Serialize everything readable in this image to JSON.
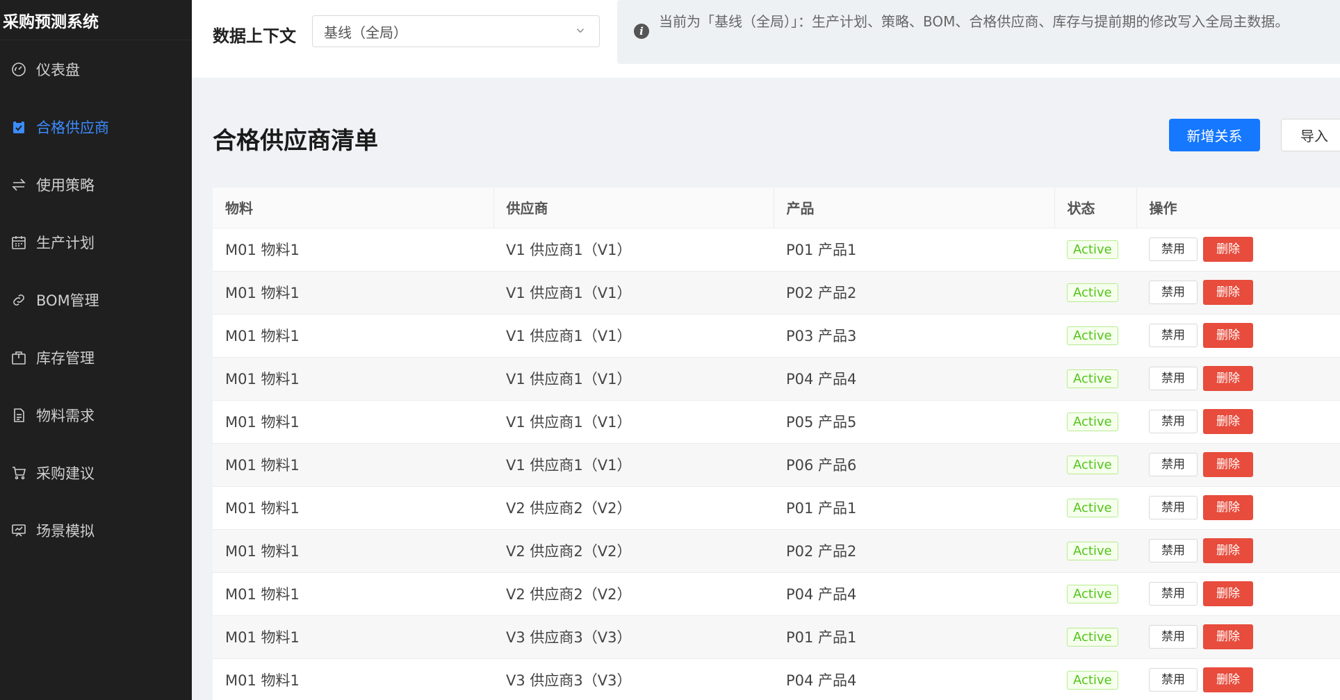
{
  "app": {
    "title": "采购预测系统"
  },
  "sidebar": {
    "items": [
      {
        "label": "仪表盘",
        "icon": "dashboard-icon",
        "active": false
      },
      {
        "label": "合格供应商",
        "icon": "checklist-icon",
        "active": true
      },
      {
        "label": "使用策略",
        "icon": "swap-icon",
        "active": false
      },
      {
        "label": "生产计划",
        "icon": "calendar-icon",
        "active": false
      },
      {
        "label": "BOM管理",
        "icon": "link-icon",
        "active": false
      },
      {
        "label": "库存管理",
        "icon": "box-icon",
        "active": false
      },
      {
        "label": "物料需求",
        "icon": "document-icon",
        "active": false
      },
      {
        "label": "采购建议",
        "icon": "cart-icon",
        "active": false
      },
      {
        "label": "场景模拟",
        "icon": "presentation-icon",
        "active": false
      }
    ]
  },
  "context": {
    "label": "数据上下文",
    "selected": "基线（全局）",
    "info": "当前为「基线（全局）」：生产计划、策略、BOM、合格供应商、库存与提前期的修改写入全局主数据。"
  },
  "main": {
    "title": "合格供应商清单",
    "add_button": "新增关系",
    "import_button": "导入"
  },
  "table": {
    "headers": {
      "material": "物料",
      "supplier": "供应商",
      "product": "产品",
      "status": "状态",
      "actions": "操作"
    },
    "disable_label": "禁用",
    "delete_label": "删除",
    "rows": [
      {
        "material": "M01 物料1",
        "supplier": "V1 供应商1（V1）",
        "product": "P01 产品1",
        "status": "Active"
      },
      {
        "material": "M01 物料1",
        "supplier": "V1 供应商1（V1）",
        "product": "P02 产品2",
        "status": "Active"
      },
      {
        "material": "M01 物料1",
        "supplier": "V1 供应商1（V1）",
        "product": "P03 产品3",
        "status": "Active"
      },
      {
        "material": "M01 物料1",
        "supplier": "V1 供应商1（V1）",
        "product": "P04 产品4",
        "status": "Active"
      },
      {
        "material": "M01 物料1",
        "supplier": "V1 供应商1（V1）",
        "product": "P05 产品5",
        "status": "Active"
      },
      {
        "material": "M01 物料1",
        "supplier": "V1 供应商1（V1）",
        "product": "P06 产品6",
        "status": "Active"
      },
      {
        "material": "M01 物料1",
        "supplier": "V2 供应商2（V2）",
        "product": "P01 产品1",
        "status": "Active"
      },
      {
        "material": "M01 物料1",
        "supplier": "V2 供应商2（V2）",
        "product": "P02 产品2",
        "status": "Active"
      },
      {
        "material": "M01 物料1",
        "supplier": "V2 供应商2（V2）",
        "product": "P04 产品4",
        "status": "Active"
      },
      {
        "material": "M01 物料1",
        "supplier": "V3 供应商3（V3）",
        "product": "P01 产品1",
        "status": "Active"
      },
      {
        "material": "M01 物料1",
        "supplier": "V3 供应商3（V3）",
        "product": "P04 产品4",
        "status": "Active"
      }
    ]
  },
  "colors": {
    "accent": "#1677ff",
    "sidebar_bg": "#1f1f1f",
    "danger": "#e74c3c",
    "success": "#52c41a"
  }
}
